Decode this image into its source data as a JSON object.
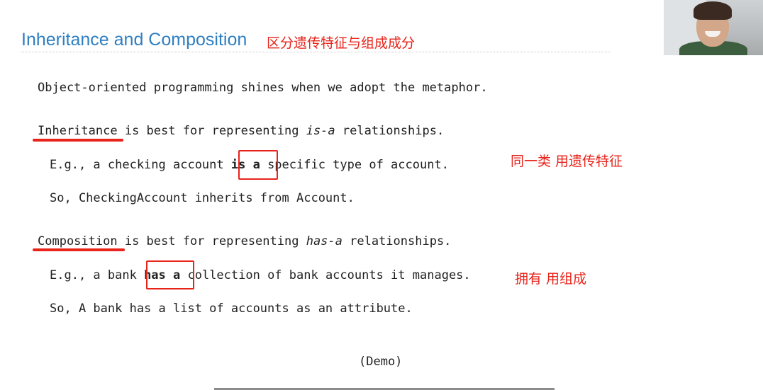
{
  "slide": {
    "title": "Inheritance and Composition",
    "title_note": "区分遗传特征与组成成分",
    "intro": "Object-oriented programming shines when we adopt the metaphor.",
    "inheritance": {
      "term": "Inheritance",
      "rest_before": " is best for representing ",
      "relation": "is-a",
      "rest_after": " relationships.",
      "example_before": "E.g., a checking account ",
      "example_keyword": "is a",
      "example_after": " specific type of account.",
      "so_line": "So, CheckingAccount inherits from Account.",
      "note": "同一类 用遗传特征"
    },
    "composition": {
      "term": "Composition",
      "rest_before": " is best for representing ",
      "relation": "has-a",
      "rest_after": " relationships.",
      "example_before": "E.g., a bank ",
      "example_keyword": "has a",
      "example_after": " collection of bank accounts it manages.",
      "so_line": "So, A bank has a list of accounts as an attribute.",
      "note": "拥有 用组成"
    },
    "demo": "(Demo)"
  },
  "colors": {
    "title": "#2f7fc1",
    "annotation": "#e8231a",
    "body_text": "#222222"
  }
}
